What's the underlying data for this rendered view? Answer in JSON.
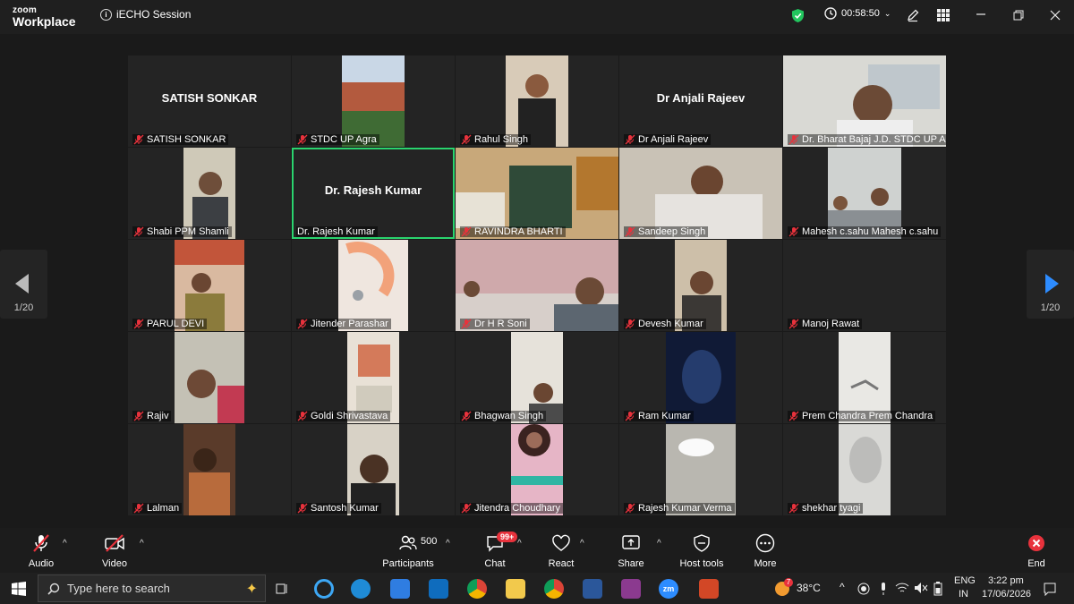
{
  "app": {
    "brand_top": "zoom",
    "brand_bottom": "Workplace",
    "session_title": "iECHO Session",
    "timer": "00:58:50"
  },
  "nav": {
    "left_page": "1/20",
    "right_page": "1/20"
  },
  "tiles": [
    {
      "name": "SATISH SONKAR",
      "big": "SATISH SONKAR"
    },
    {
      "name": "STDC UP Agra"
    },
    {
      "name": "Rahul Singh"
    },
    {
      "name": "Dr Anjali Rajeev",
      "big": "Dr Anjali Rajeev"
    },
    {
      "name": "Dr. Bharat Bajaj J.D. STDC UP Agra"
    },
    {
      "name": "Shabi PPM Shamli"
    },
    {
      "name": "Dr. Rajesh Kumar",
      "big": "Dr. Rajesh Kumar"
    },
    {
      "name": "RAVINDRA BHARTI"
    },
    {
      "name": "Sandeep  Singh"
    },
    {
      "name": "Mahesh c.sahu Mahesh c.sahu"
    },
    {
      "name": "PARUL DEVI"
    },
    {
      "name": "Jitender Parashar"
    },
    {
      "name": "Dr H R Soni"
    },
    {
      "name": "Devesh Kumar"
    },
    {
      "name": "Manoj Rawat"
    },
    {
      "name": "Rajiv"
    },
    {
      "name": "Goldi Shrivastava"
    },
    {
      "name": "Bhagwan Singh"
    },
    {
      "name": "Ram Kumar"
    },
    {
      "name": "Prem Chandra Prem Chandra"
    },
    {
      "name": "Lalman"
    },
    {
      "name": "Santosh Kumar"
    },
    {
      "name": "Jitendra Choudhary"
    },
    {
      "name": "Rajesh Kumar Verma"
    },
    {
      "name": "shekhar tyagi"
    }
  ],
  "toolbar": {
    "audio": "Audio",
    "video": "Video",
    "participants": "Participants",
    "participant_count": "500",
    "chat": "Chat",
    "chat_badge": "99+",
    "react": "React",
    "share": "Share",
    "host_tools": "Host tools",
    "more": "More",
    "end": "End"
  },
  "taskbar": {
    "search_placeholder": "Type here to search",
    "weather_badge": "7",
    "temperature": "38°C",
    "lang_top": "ENG",
    "lang_bottom": "IN",
    "time": "3:22 pm",
    "date": "17/06/2026"
  },
  "colors": {
    "active_speaker": "#2ad46e",
    "end_red": "#e8323c",
    "shield_green": "#22c55e"
  }
}
